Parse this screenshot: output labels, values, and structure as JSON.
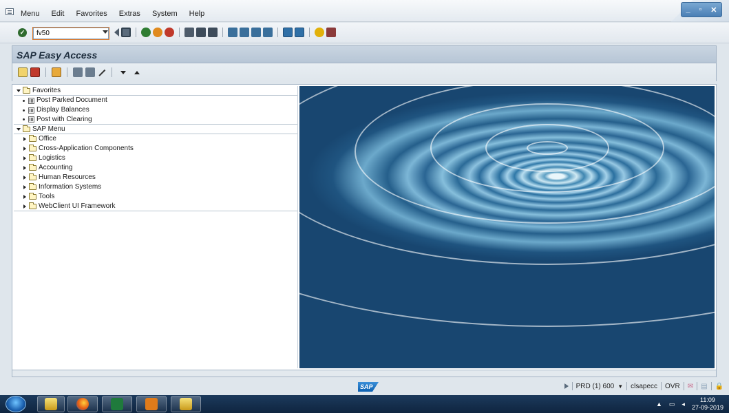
{
  "menubar": {
    "items": [
      {
        "label": "Menu"
      },
      {
        "label": "Edit"
      },
      {
        "label": "Favorites"
      },
      {
        "label": "Extras"
      },
      {
        "label": "System"
      },
      {
        "label": "Help"
      }
    ]
  },
  "toolbar": {
    "command_value": "fv50"
  },
  "title": {
    "text": "SAP Easy Access"
  },
  "tree": {
    "favorites_label": "Favorites",
    "favorites": [
      {
        "label": "Post Parked Document"
      },
      {
        "label": "Display Balances"
      },
      {
        "label": "Post with Clearing"
      }
    ],
    "sap_menu_label": "SAP Menu",
    "sap_menu": [
      {
        "label": "Office"
      },
      {
        "label": "Cross-Application Components"
      },
      {
        "label": "Logistics"
      },
      {
        "label": "Accounting"
      },
      {
        "label": "Human Resources"
      },
      {
        "label": "Information Systems"
      },
      {
        "label": "Tools"
      },
      {
        "label": "WebClient UI Framework"
      }
    ]
  },
  "status": {
    "logo": "SAP",
    "system": "PRD (1) 600",
    "server": "clsapecc",
    "mode": "OVR"
  },
  "taskbar": {
    "time": "11:09",
    "date": "27-09-2019"
  },
  "colors": {
    "title_bg": "#c9d5e1",
    "taskbar": "#1c3a5c",
    "sap_blue": "#0a5fb0"
  }
}
